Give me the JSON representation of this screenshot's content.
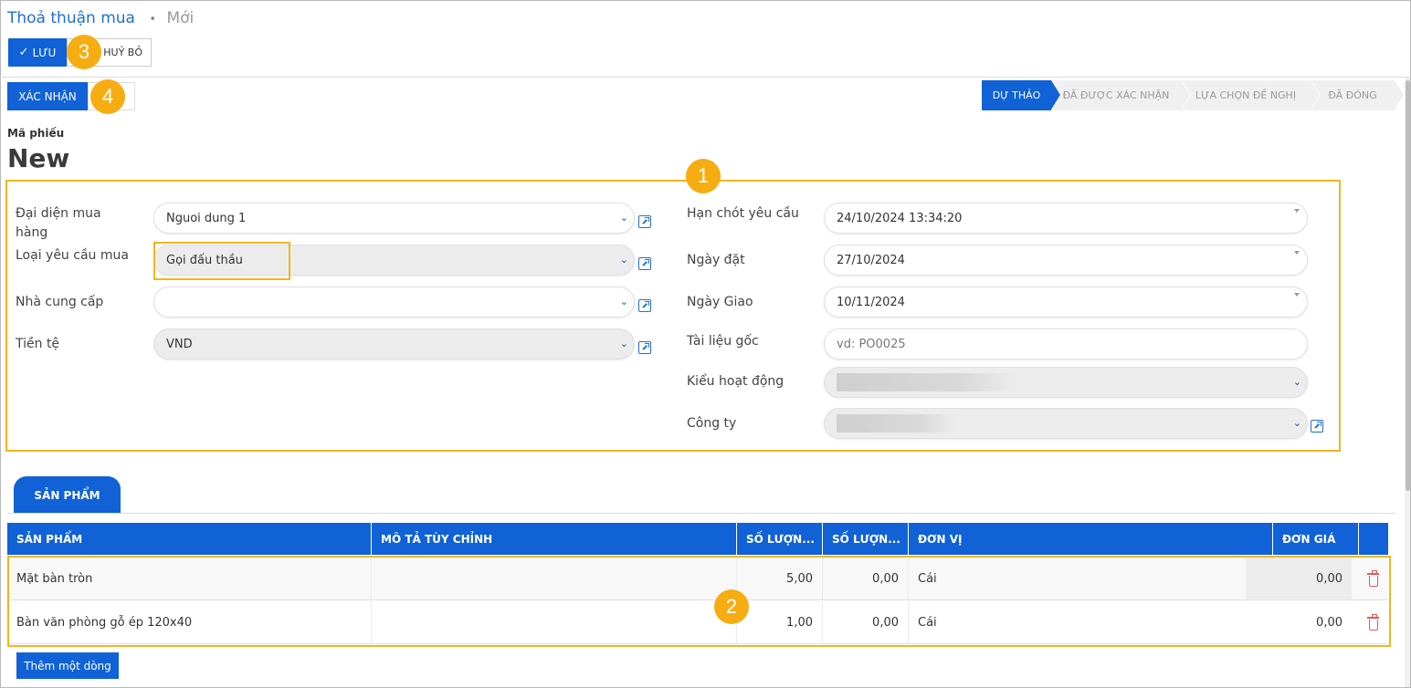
{
  "breadcrumb": {
    "parent": "Thoả thuận mua",
    "separator": "•",
    "current": "Mới"
  },
  "toolbar": {
    "save_label": "LƯU",
    "cancel_label": "HUỶ BỎ",
    "confirm_label": "XÁC NHẬN"
  },
  "callouts": [
    "1",
    "2",
    "3",
    "4"
  ],
  "stages": [
    "DỰ THẢO",
    "ĐÃ ĐƯỢC XÁC NHẬN",
    "LỰA CHỌN ĐỀ NGHỊ",
    "ĐÃ ĐÓNG"
  ],
  "active_stage": "DỰ THẢO",
  "record": {
    "code_label": "Mã phiếu",
    "code_value": "New"
  },
  "left_fields": {
    "buyer": {
      "label": "Đại diện mua hàng",
      "value": "Nguoi dung 1"
    },
    "request_type": {
      "label": "Loại yêu cầu mua",
      "value": "Gọi đấu thầu"
    },
    "vendor": {
      "label": "Nhà cung cấp",
      "value": ""
    },
    "currency": {
      "label": "Tiền tệ",
      "value": "VND"
    }
  },
  "right_fields": {
    "deadline": {
      "label": "Hạn chót yêu cầu",
      "value": "24/10/2024 13:34:20"
    },
    "order_date": {
      "label": "Ngày đặt",
      "value": "27/10/2024"
    },
    "delivery_date": {
      "label": "Ngày Giao",
      "value": "10/11/2024"
    },
    "source_doc": {
      "label": "Tài liệu gốc",
      "placeholder": "vd: PO0025"
    },
    "operation_type": {
      "label": "Kiểu hoạt động",
      "value": ""
    },
    "company": {
      "label": "Công ty",
      "value": ""
    }
  },
  "tabs": [
    "SẢN PHẨM"
  ],
  "table": {
    "columns": [
      "SẢN PHẨM",
      "MÔ TẢ TÙY CHỈNH",
      "SỐ LƯỢN...",
      "SỐ LƯỢN...",
      "ĐƠN VỊ",
      "ĐƠN GIÁ"
    ],
    "rows": [
      {
        "product": "Mặt bàn tròn",
        "description": "",
        "qty": "5,00",
        "qty2": "0,00",
        "unit": "Cái",
        "price": "0,00"
      },
      {
        "product": "Bàn văn phòng gỗ ép 120x40",
        "description": "",
        "qty": "1,00",
        "qty2": "0,00",
        "unit": "Cái",
        "price": "0,00"
      }
    ],
    "add_line_label": "Thêm một dòng"
  },
  "colors": {
    "primary": "#1062d6",
    "highlight": "#f2b521",
    "badge": "#f6ad12",
    "link": "#1f6fd6"
  }
}
